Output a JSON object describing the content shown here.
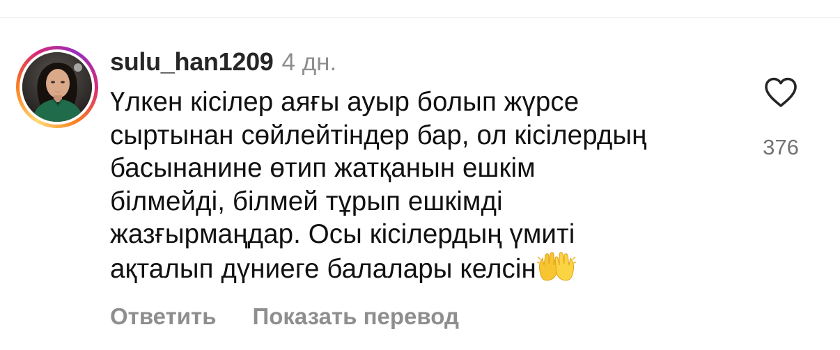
{
  "comment": {
    "username": "sulu_han1209",
    "time": "4 дн.",
    "text_lines": [
      "Үлкен кісілер аяғы ауыр болып жүрсе",
      "сыртынан сөйлейтіндер бар, ол кісілердың",
      "басынанине өтип жатқанын ешкім",
      "білмейді, білмей тұрып ешкімді",
      "жазғырмаңдар. Осы кісілердың үмиті",
      "ақталып дүниеге балалары келсін"
    ],
    "emoji": "raising-hands-emoji",
    "like_icon": "heart-icon",
    "like_count": "376",
    "actions": {
      "reply": "Ответить",
      "translate": "Показать перевод"
    }
  },
  "colors": {
    "username": "#262626",
    "secondary": "#8e8e8e",
    "story_ring_start": "#feda75",
    "story_ring_end": "#d62976"
  }
}
